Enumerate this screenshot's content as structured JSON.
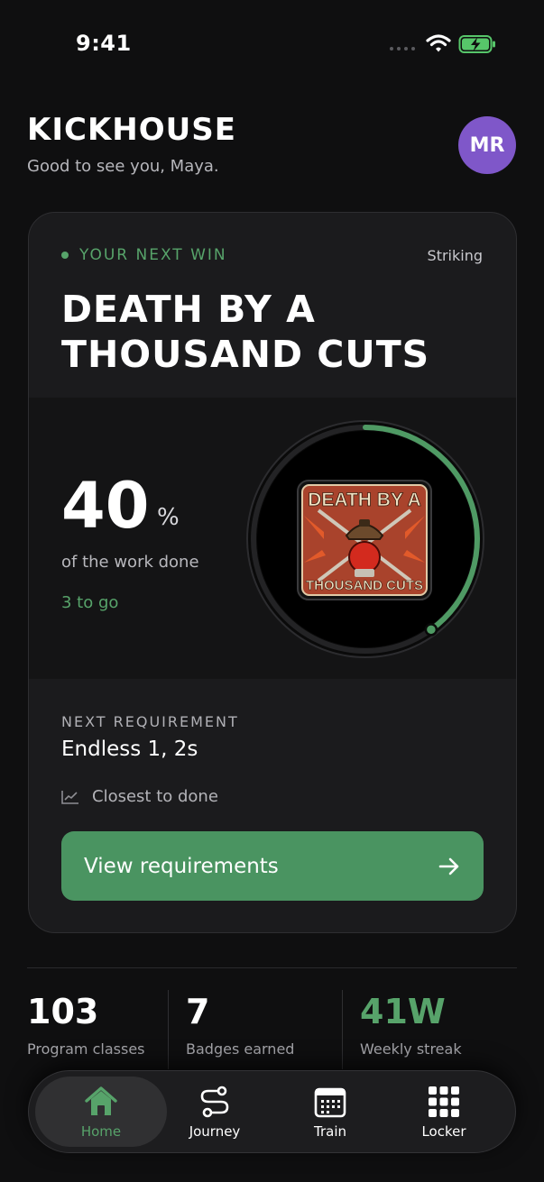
{
  "status_bar": {
    "time": "9:41"
  },
  "header": {
    "brand": "KICKHOUSE",
    "greeting": "Good to see you, Maya.",
    "avatar_initials": "MR",
    "avatar_color": "#7f57c9"
  },
  "next_win": {
    "eyebrow": "YOUR NEXT WIN",
    "category": "Striking",
    "title": "DEATH BY A THOUSAND CUTS",
    "percent": "40",
    "percent_sign": "%",
    "progress_fraction": 0.4,
    "work_label": "of the work done",
    "remaining": "3 to go",
    "badge_art_text": [
      "DEATH BY A",
      "THOUSAND CUTS"
    ],
    "next_requirement_label": "NEXT REQUIREMENT",
    "next_requirement": "Endless 1, 2s",
    "hint": "Closest to done",
    "cta_label": "View requirements"
  },
  "stats": [
    {
      "value": "103",
      "label": "Program classes"
    },
    {
      "value": "7",
      "label": "Badges earned"
    },
    {
      "value": "41W",
      "label": "Weekly streak"
    }
  ],
  "tabs": [
    {
      "label": "Home",
      "icon": "home-icon",
      "active": true
    },
    {
      "label": "Journey",
      "icon": "route-icon",
      "active": false
    },
    {
      "label": "Train",
      "icon": "calendar-icon",
      "active": false
    },
    {
      "label": "Locker",
      "icon": "grid-icon",
      "active": false
    }
  ],
  "colors": {
    "accent": "#57a36a",
    "cta": "#4a9461",
    "background": "#0f0f10",
    "card": "#1b1b1d"
  }
}
